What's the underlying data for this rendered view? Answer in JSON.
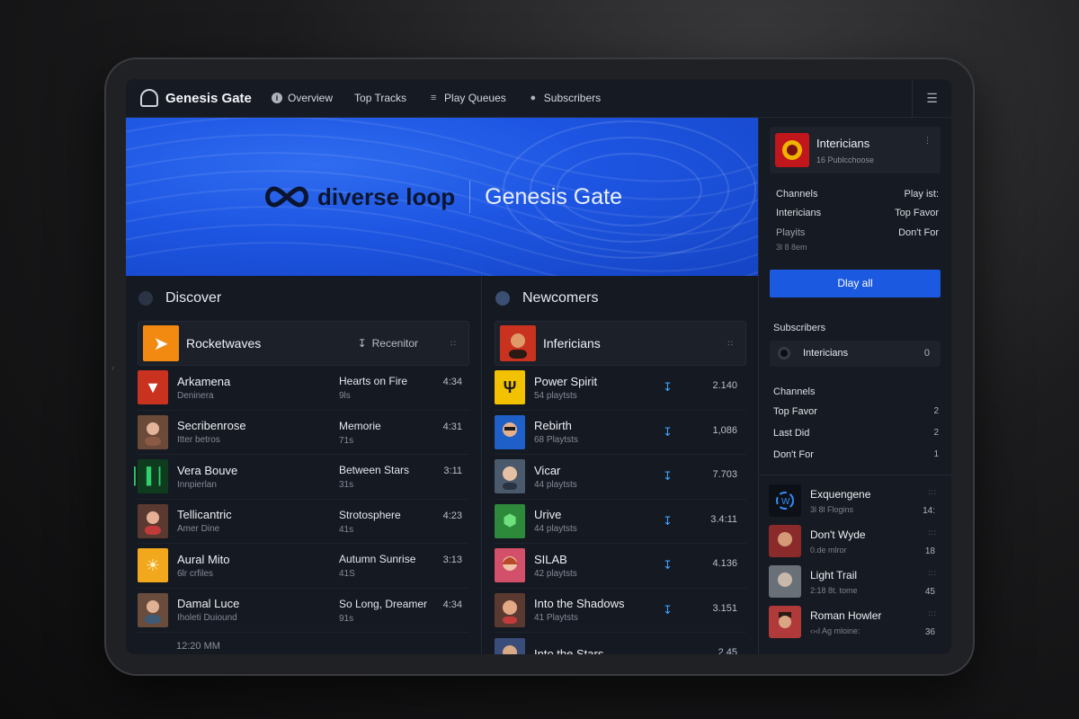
{
  "app": {
    "brand": "Genesis Gate"
  },
  "nav": [
    {
      "label": "Overview",
      "icon": "info-icon"
    },
    {
      "label": "Top Tracks",
      "icon": ""
    },
    {
      "label": "Play Queues",
      "icon": "queue-icon"
    },
    {
      "label": "Subscribers",
      "icon": "user-icon"
    }
  ],
  "hero": {
    "logo_text": "diverse loop",
    "title": "Genesis Gate"
  },
  "discover": {
    "title": "Discover",
    "featured": {
      "name": "Rocketwaves",
      "action": "Recenitor",
      "more": "∷"
    },
    "rows": [
      {
        "title": "Arkamena",
        "sub": "Deninera",
        "track": "Hearts on Fire",
        "track_sub": "9ls",
        "duration": "4:34",
        "color": "#c8321f"
      },
      {
        "title": "Secribenrose",
        "sub": "Itter betros",
        "track": "Memorie",
        "track_sub": "71s",
        "duration": "4:31",
        "color": "#6b4a3a"
      },
      {
        "title": "Vera Bouve",
        "sub": "Innpierlan",
        "track": "Between Stars",
        "track_sub": "31s",
        "duration": "3:11",
        "color": "#0f3b1f"
      },
      {
        "title": "Tellicantric",
        "sub": "Amer Dine",
        "track": "Strotosphere",
        "track_sub": "41s",
        "duration": "4:23",
        "color": "#5a3a30"
      },
      {
        "title": "Aural Mito",
        "sub": "6lr crfiles",
        "track": "Autumn Sunrise",
        "track_sub": "41S",
        "duration": "3:13",
        "color": "#f1a81d"
      },
      {
        "title": "Damal Luce",
        "sub": "Iholeti Duiound",
        "track": "So Long, Dreamer",
        "track_sub": "91s",
        "duration": "4:34",
        "color": "#6a4c3c"
      }
    ],
    "timestamp": "12:20 MM"
  },
  "newcomers": {
    "title": "Newcomers",
    "featured": {
      "name": "Infericians",
      "more": "∷"
    },
    "rows": [
      {
        "title": "Power Spirit",
        "sub": "54 playtsts",
        "count": "2.140",
        "color": "#f2c200"
      },
      {
        "title": "Rebirth",
        "sub": "68 Playtsts",
        "count": "1,086",
        "color": "#1f5fc8"
      },
      {
        "title": "Vicar",
        "sub": "44 playtsts",
        "count": "7.703",
        "color": "#4a5a6c"
      },
      {
        "title": "Urive",
        "sub": "44 playtsts",
        "count": "3.4:11",
        "color": "#2d8a3a"
      },
      {
        "title": "SILAB",
        "sub": "42 playtsts",
        "count": "4.136",
        "color": "#d2506a"
      },
      {
        "title": "Into the Shadows",
        "sub": "41 Playtsts",
        "count": "3.151",
        "color": "#5a3a30"
      },
      {
        "title": "Into the Stars",
        "sub": "",
        "count": "2.45",
        "color": "#3a4d7a"
      }
    ]
  },
  "profile": {
    "name": "Intericians",
    "sub": "16 Publcchoose"
  },
  "details": [
    {
      "left": "Channels",
      "right": "Play ist:"
    },
    {
      "left": "Intericians",
      "right": "Top Favor"
    },
    {
      "left": "Playits",
      "right": "Don't For"
    }
  ],
  "details_small": "3l 8 8em",
  "play_all": "Dlay all",
  "subscribers": {
    "title": "Subscribers",
    "name": "Intericians",
    "badge": "0"
  },
  "channels": {
    "title": "Channels",
    "items": [
      {
        "label": "Top Favor",
        "n": "2"
      },
      {
        "label": "Last Did",
        "n": "2"
      },
      {
        "label": "Don't For",
        "n": "1"
      }
    ]
  },
  "mini": [
    {
      "title": "Exquengene",
      "sub": "3l 8l Flogins",
      "num": "14:",
      "color": "#0d1117"
    },
    {
      "title": "Don't Wyde",
      "sub": "0.de mlror",
      "num": "18",
      "color": "#8a2a2a"
    },
    {
      "title": "Light  Trail",
      "sub": "2:18 8t. tome",
      "num": "45",
      "color": "#6a7078"
    },
    {
      "title": "Roman Howler",
      "sub": "‹›‹l Ag mloine:",
      "num": "36",
      "color": "#b03a3a"
    }
  ],
  "colors": {
    "accent": "#1b59e0",
    "hero": "#1d55e2",
    "background": "#12161e",
    "download": "#3fa2ff"
  }
}
